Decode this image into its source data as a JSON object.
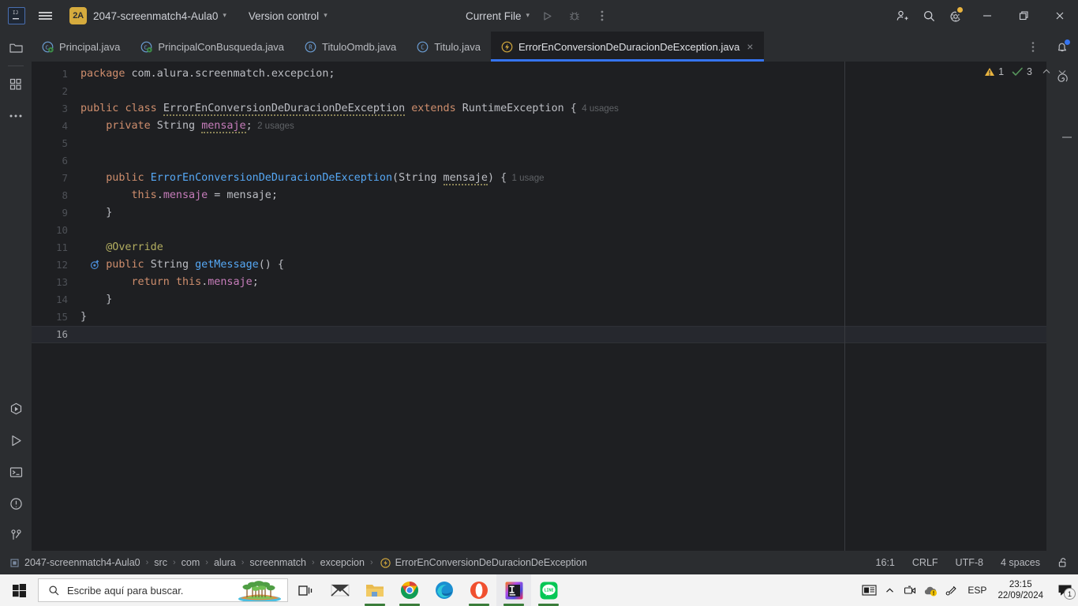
{
  "titlebar": {
    "logo_icon": "intellij-idea-logo",
    "menu_icon": "hamburger-menu-icon",
    "project_badge": "2A",
    "project_name": "2047-screenmatch4-Aula0",
    "vcs_label": "Version control",
    "run_config": "Current File",
    "run_icon": "run-triangle-icon",
    "debug_icon": "debug-bug-icon",
    "more_icon": "more-vertical-icon",
    "share_icon": "add-user-icon",
    "search_icon": "search-icon",
    "settings_icon": "gear-icon",
    "minimize_icon": "minimize-icon",
    "maximize_icon": "maximize-restore-icon",
    "close_icon": "close-icon",
    "chevron": "⌄"
  },
  "left_rail": {
    "top": [
      {
        "name": "project-tool-window",
        "icon": "folder-icon"
      },
      {
        "name": "commit-tool-window",
        "icon": "grid-squares-icon"
      },
      {
        "name": "more-tool-windows",
        "icon": "ellipsis-icon"
      }
    ],
    "bottom": [
      {
        "name": "services-tool-window",
        "icon": "services-hexagon-icon"
      },
      {
        "name": "run-tool-window",
        "icon": "run-triangle-icon"
      },
      {
        "name": "terminal-tool-window",
        "icon": "terminal-icon"
      },
      {
        "name": "problems-tool-window",
        "icon": "problems-exclamation-icon"
      },
      {
        "name": "version-control-tool-window",
        "icon": "git-branch-icon"
      }
    ]
  },
  "right_rail": [
    {
      "name": "notifications-tool-window",
      "icon": "bell-icon",
      "has_dot": true
    },
    {
      "name": "ai-assistant-tool-window",
      "icon": "spiral-icon",
      "has_dot": false
    }
  ],
  "tabs": [
    {
      "label": "Principal.java",
      "icon": "java-class-run-icon",
      "active": false,
      "closable": false
    },
    {
      "label": "PrincipalConBusqueda.java",
      "icon": "java-class-run-icon",
      "active": false,
      "closable": false
    },
    {
      "label": "TituloOmdb.java",
      "icon": "java-record-icon",
      "active": false,
      "closable": false
    },
    {
      "label": "Titulo.java",
      "icon": "java-class-icon",
      "active": false,
      "closable": false
    },
    {
      "label": "ErrorEnConversionDeDuracionDeException.java",
      "icon": "java-exception-icon",
      "active": true,
      "closable": true
    }
  ],
  "tabs_overflow_icon": "more-vertical-icon",
  "editor": {
    "current_line": 16,
    "total_lines": 16,
    "gutter_marker_line": 12,
    "gutter_marker_icon": "overriding-method-icon",
    "lines": [
      {
        "n": 1,
        "tokens": [
          {
            "t": "package ",
            "c": "kw"
          },
          {
            "t": "com.alura.screenmatch.excepcion;",
            "c": "code"
          }
        ]
      },
      {
        "n": 2,
        "tokens": []
      },
      {
        "n": 3,
        "tokens": [
          {
            "t": "public ",
            "c": "kw"
          },
          {
            "t": "class ",
            "c": "kw"
          },
          {
            "t": "ErrorEnConversionDeDuracionDeException",
            "c": "cls squig"
          },
          {
            "t": " ",
            "c": "code"
          },
          {
            "t": "extends ",
            "c": "kw"
          },
          {
            "t": "RuntimeException",
            "c": "cls"
          },
          {
            "t": " {",
            "c": "code"
          },
          {
            "t": "  4 usages",
            "c": "usages"
          }
        ]
      },
      {
        "n": 4,
        "tokens": [
          {
            "t": "    ",
            "c": "code"
          },
          {
            "t": "private ",
            "c": "kw"
          },
          {
            "t": "String ",
            "c": "typ"
          },
          {
            "t": "mensaje",
            "c": "fld squig"
          },
          {
            "t": ";",
            "c": "code"
          },
          {
            "t": "  2 usages",
            "c": "usages"
          }
        ]
      },
      {
        "n": 5,
        "tokens": []
      },
      {
        "n": 6,
        "tokens": []
      },
      {
        "n": 7,
        "tokens": [
          {
            "t": "    ",
            "c": "code"
          },
          {
            "t": "public ",
            "c": "kw"
          },
          {
            "t": "ErrorEnConversionDeDuracionDeException",
            "c": "ctor"
          },
          {
            "t": "(",
            "c": "code"
          },
          {
            "t": "String ",
            "c": "typ"
          },
          {
            "t": "mensaje",
            "c": "code squig"
          },
          {
            "t": ") {",
            "c": "code"
          },
          {
            "t": "  1 usage",
            "c": "usages"
          }
        ]
      },
      {
        "n": 8,
        "tokens": [
          {
            "t": "        ",
            "c": "code"
          },
          {
            "t": "this",
            "c": "kw"
          },
          {
            "t": ".",
            "c": "code"
          },
          {
            "t": "mensaje",
            "c": "fld"
          },
          {
            "t": " = mensaje;",
            "c": "code"
          }
        ]
      },
      {
        "n": 9,
        "tokens": [
          {
            "t": "    }",
            "c": "code"
          }
        ]
      },
      {
        "n": 10,
        "tokens": []
      },
      {
        "n": 11,
        "tokens": [
          {
            "t": "    ",
            "c": "code"
          },
          {
            "t": "@Override",
            "c": "anno"
          }
        ]
      },
      {
        "n": 12,
        "tokens": [
          {
            "t": "    ",
            "c": "code"
          },
          {
            "t": "public ",
            "c": "kw"
          },
          {
            "t": "String ",
            "c": "typ"
          },
          {
            "t": "getMessage",
            "c": "mth"
          },
          {
            "t": "() {",
            "c": "code"
          }
        ]
      },
      {
        "n": 13,
        "tokens": [
          {
            "t": "        ",
            "c": "code"
          },
          {
            "t": "return ",
            "c": "kw"
          },
          {
            "t": "this",
            "c": "kw"
          },
          {
            "t": ".",
            "c": "code"
          },
          {
            "t": "mensaje",
            "c": "fld"
          },
          {
            "t": ";",
            "c": "code"
          }
        ]
      },
      {
        "n": 14,
        "tokens": [
          {
            "t": "    }",
            "c": "code"
          }
        ]
      },
      {
        "n": 15,
        "tokens": [
          {
            "t": "}",
            "c": "code"
          }
        ]
      },
      {
        "n": 16,
        "tokens": []
      }
    ]
  },
  "inspections": {
    "warning_icon": "warning-triangle-icon",
    "warning_count": "1",
    "ok_icon": "inspection-check-icon",
    "ok_count": "3",
    "prev_icon": "chevron-up-icon",
    "next_icon": "chevron-down-icon"
  },
  "status_bar": {
    "breadcrumb_icon": "project-module-icon",
    "breadcrumbs": [
      "2047-screenmatch4-Aula0",
      "src",
      "com",
      "alura",
      "screenmatch",
      "excepcion"
    ],
    "breadcrumb_last": "ErrorEnConversionDeDuracionDeException",
    "breadcrumb_last_icon": "java-exception-icon",
    "separator": "›",
    "caret_position": "16:1",
    "line_separator": "CRLF",
    "encoding": "UTF-8",
    "indent": "4 spaces",
    "lock_icon": "unlocked-padlock-icon"
  },
  "taskbar": {
    "start_icon": "windows-start-icon",
    "search_icon": "search-icon",
    "search_placeholder": "Escribe aquí para buscar.",
    "search_value": "",
    "cortana_icon": "weather-island-icon",
    "taskview_icon": "task-view-icon",
    "apps": [
      {
        "name": "mail-app",
        "icon": "mail-envelope-icon",
        "running": false,
        "active": false
      },
      {
        "name": "file-explorer-app",
        "icon": "file-explorer-folder-icon",
        "running": true,
        "active": false
      },
      {
        "name": "google-chrome-app",
        "icon": "chrome-icon",
        "running": true,
        "active": false
      },
      {
        "name": "microsoft-edge-app",
        "icon": "edge-icon",
        "running": false,
        "active": false
      },
      {
        "name": "opera-app",
        "icon": "opera-icon",
        "running": true,
        "active": false
      },
      {
        "name": "intellij-idea-app",
        "icon": "intellij-idea-icon",
        "running": true,
        "active": true
      },
      {
        "name": "line-app",
        "icon": "line-messenger-icon",
        "running": true,
        "active": false
      }
    ],
    "tray": [
      {
        "name": "news-and-interests",
        "icon": "news-icon"
      },
      {
        "name": "show-hidden-icons",
        "icon": "chevron-up-icon"
      },
      {
        "name": "camera-tray",
        "icon": "camera-icon"
      },
      {
        "name": "onedrive-tray",
        "icon": "cloud-warning-icon"
      },
      {
        "name": "network-tray",
        "icon": "network-pen-icon"
      }
    ],
    "language": "ESP",
    "time": "23:15",
    "date": "22/09/2024",
    "notification_icon": "notification-chat-icon",
    "notification_count": "1"
  },
  "colors": {
    "accent": "#3574f0",
    "titlebar_bg": "#2b2d30",
    "editor_bg": "#1e1f22",
    "badge_yellow": "#d6ab3d",
    "warning": "#e8b33f",
    "ok_green": "#57965c"
  }
}
